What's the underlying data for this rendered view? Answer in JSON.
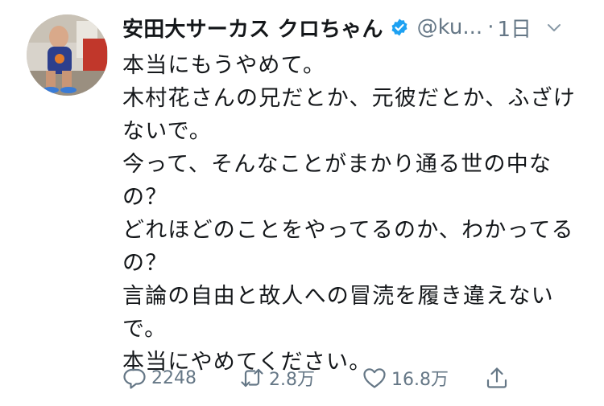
{
  "tweet": {
    "user": {
      "display_name": "安田大サーカス クロちゃん",
      "handle": "@ku...",
      "verified": true
    },
    "separator": "·",
    "timestamp": "1日",
    "lines": [
      "本当にもうやめて。",
      "木村花さんの兄だとか、元彼だとか、ふざけ",
      "ないで。",
      "今って、そんなことがまかり通る世の中な",
      "の？",
      "どれほどのことをやってるのか、わかってる",
      "の？",
      "言論の自由と故人への冒涜を履き違えない",
      "で。",
      "本当にやめてください。"
    ],
    "actions": {
      "reply_count": "2248",
      "retweet_count": "2.8万",
      "like_count": "16.8万"
    }
  },
  "colors": {
    "text": "#14171a",
    "secondary": "#657786",
    "verified": "#1da1f2",
    "background": "#ffffff"
  },
  "icons": {
    "verified": "verified-badge-icon",
    "more": "chevron-down-icon",
    "reply": "reply-icon",
    "retweet": "retweet-icon",
    "like": "heart-icon",
    "share": "share-icon"
  }
}
